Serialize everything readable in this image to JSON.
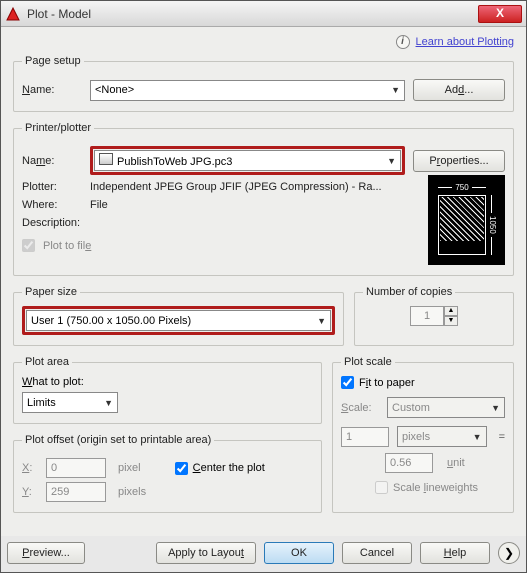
{
  "window": {
    "title": "Plot - Model"
  },
  "learn": {
    "label": "Learn about Plotting"
  },
  "pageSetup": {
    "legend": "Page setup",
    "nameLabel": "Name:",
    "nameValue": "<None>",
    "addButton": "Add..."
  },
  "printer": {
    "legend": "Printer/plotter",
    "nameLabel": "Name:",
    "nameValue": "PublishToWeb JPG.pc3",
    "propertiesButton": "Properties...",
    "plotterLabel": "Plotter:",
    "plotterValue": "Independent JPEG Group JFIF (JPEG Compression) - Ra...",
    "whereLabel": "Where:",
    "whereValue": "File",
    "descLabel": "Description:",
    "plotToFile": "Plot to file",
    "previewW": "750",
    "previewH": "1050"
  },
  "paper": {
    "legend": "Paper size",
    "value": "User 1 (750.00 x 1050.00 Pixels)"
  },
  "copies": {
    "legend": "Number of copies",
    "value": "1"
  },
  "plotArea": {
    "legend": "Plot area",
    "whatLabel": "What to plot:",
    "whatValue": "Limits"
  },
  "offset": {
    "legend": "Plot offset (origin set to printable area)",
    "xLabel": "X:",
    "xValue": "0",
    "yLabel": "Y:",
    "yValue": "259",
    "unit": "pixel",
    "unitPlural": "pixels",
    "centerLabel": "Center the plot"
  },
  "scale": {
    "legend": "Plot scale",
    "fitLabel": "Fit to paper",
    "scaleLabel": "Scale:",
    "scaleValue": "Custom",
    "num": "1",
    "numUnit": "pixels",
    "den": "0.56",
    "denUnit": "unit",
    "lwLabel": "Scale lineweights"
  },
  "footer": {
    "preview": "Preview...",
    "apply": "Apply to Layout",
    "ok": "OK",
    "cancel": "Cancel",
    "help": "Help"
  }
}
